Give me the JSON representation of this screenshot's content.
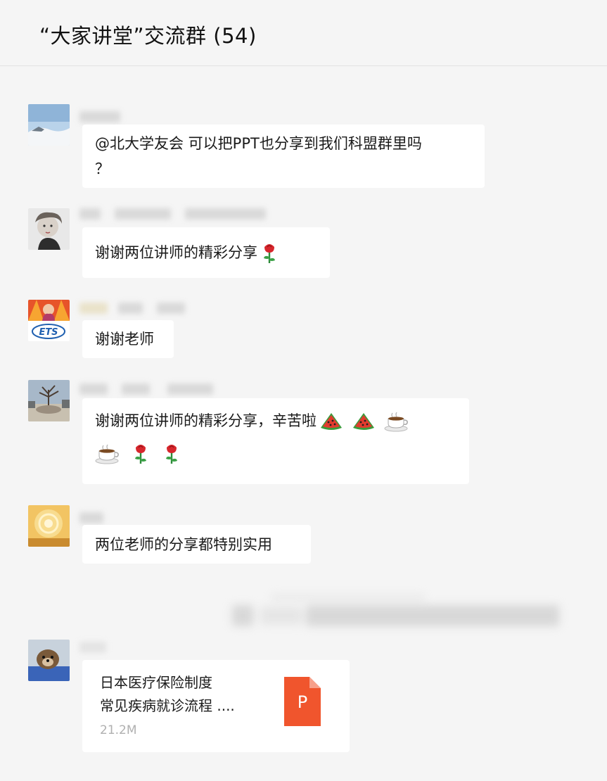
{
  "header": {
    "title": "“大家讲堂”交流群 (54)"
  },
  "messages": [
    {
      "line1": "@北大学友会 可以把PPT也分享到我们科盟群里吗",
      "line2": "？"
    },
    {
      "text": "谢谢两位讲师的精彩分享"
    },
    {
      "text": "谢谢老师"
    },
    {
      "line1": "谢谢两位讲师的精彩分享，辛苦啦"
    },
    {
      "text": "两位老师的分享都特别实用"
    }
  ],
  "file": {
    "name_line1": "日本医疗保险制度",
    "name_line2": "常见疾病就诊流程 ....",
    "size": "21.2M",
    "type_letter": "P"
  },
  "colors": {
    "background": "#f5f5f5",
    "bubble": "#ffffff",
    "file_icon": "#f0552d"
  },
  "icons": [
    "rose-emoji",
    "watermelon-emoji",
    "coffee-emoji",
    "ppt-file-icon"
  ]
}
